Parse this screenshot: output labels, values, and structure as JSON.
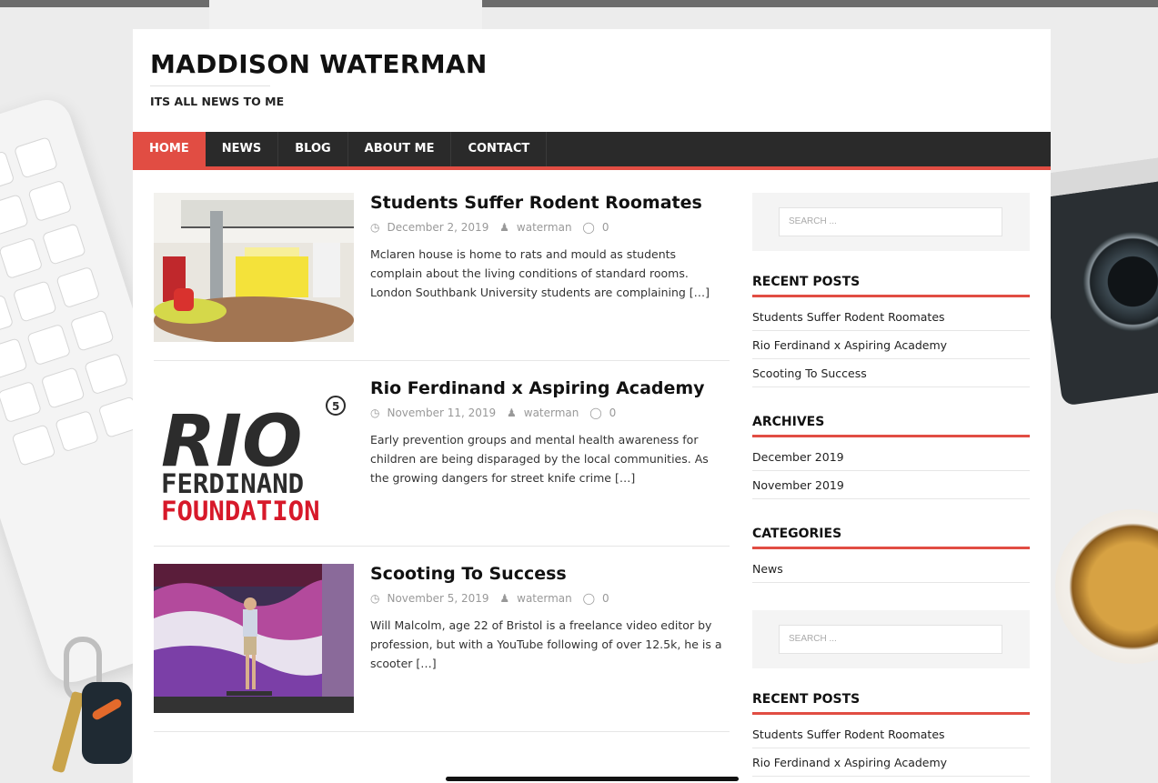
{
  "site": {
    "title": "MADDISON WATERMAN",
    "tagline": "ITS ALL NEWS TO ME"
  },
  "nav": [
    {
      "label": "HOME",
      "active": true
    },
    {
      "label": "NEWS",
      "active": false
    },
    {
      "label": "BLOG",
      "active": false
    },
    {
      "label": "ABOUT ME",
      "active": false
    },
    {
      "label": "CONTACT",
      "active": false
    }
  ],
  "posts": [
    {
      "title": "Students Suffer Rodent Roomates",
      "date": "December 2, 2019",
      "author": "waterman",
      "comments": "0",
      "excerpt": "Mclaren house is home to rats and mould as students complain about the living conditions of standard rooms.    London Southbank University students are complaining […]"
    },
    {
      "title": "Rio Ferdinand x Aspiring Academy",
      "date": "November 11, 2019",
      "author": "waterman",
      "comments": "0",
      "excerpt": "Early prevention groups and mental health awareness for children are being disparaged by the local communities.   As the growing dangers for street knife crime […]"
    },
    {
      "title": "Scooting To Success",
      "date": "November 5, 2019",
      "author": "waterman",
      "comments": "0",
      "excerpt": "Will Malcolm, age 22 of Bristol is a freelance video editor by profession, but with a YouTube following of over 12.5k, he is a scooter […]"
    }
  ],
  "logo_text": {
    "rio": "RIO",
    "number": "5",
    "ferdinand": "FERDINAND",
    "foundation": "FOUNDATION"
  },
  "sidebar": {
    "search_placeholder": "SEARCH ...",
    "recent_posts_title": "RECENT POSTS",
    "recent_posts": [
      "Students Suffer Rodent Roomates",
      "Rio Ferdinand x Aspiring Academy",
      "Scooting To Success"
    ],
    "archives_title": "ARCHIVES",
    "archives": [
      "December 2019",
      "November 2019"
    ],
    "categories_title": "CATEGORIES",
    "categories": [
      "News"
    ],
    "search2_placeholder": "SEARCH ...",
    "recent_posts2_title": "RECENT POSTS",
    "recent_posts2": [
      "Students Suffer Rodent Roomates",
      "Rio Ferdinand x Aspiring Academy"
    ]
  },
  "colors": {
    "accent": "#e14d43",
    "nav_bg": "#2a2a2a"
  }
}
